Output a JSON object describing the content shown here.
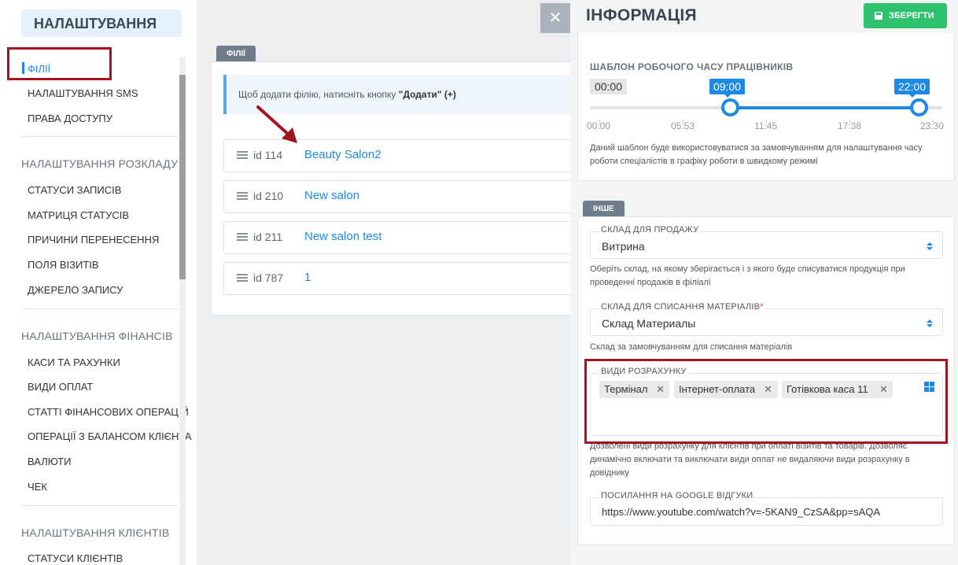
{
  "sidebar": {
    "header": "НАЛАШТУВАННЯ",
    "active_item": "ФІЛІЇ",
    "items_group1": [
      "НАЛАШТУВАННЯ SMS",
      "ПРАВА ДОСТУПУ"
    ],
    "section_schedule": "НАЛАШТУВАННЯ РОЗКЛАДУ",
    "items_schedule": [
      "СТАТУСИ ЗАПИСІВ",
      "МАТРИЦЯ СТАТУСІВ",
      "ПРИЧИНИ ПЕРЕНЕСЕННЯ",
      "ПОЛЯ ВІЗИТІВ",
      "ДЖЕРЕЛО ЗАПИСУ"
    ],
    "section_finance": "НАЛАШТУВАННЯ ФІНАНСІВ",
    "items_finance": [
      "КАСИ ТА РАХУНКИ",
      "ВИДИ ОПЛАТ",
      "СТАТТІ ФІНАНСОВИХ ОПЕРАЦІЙ",
      "ОПЕРАЦІЇ З БАЛАНСОМ КЛІЄНТА",
      "ВАЛЮТИ",
      "ЧЕК"
    ],
    "section_clients": "НАЛАШТУВАННЯ КЛІЄНТІВ",
    "items_clients": [
      "СТАТУСИ КЛІЄНТІВ"
    ]
  },
  "branches": {
    "tab_label": "ФІЛІЇ",
    "info_text_prefix": "Щоб додати філію, натисніть кнопку ",
    "info_text_bold": "\"Додати\" (+)",
    "rows": [
      {
        "id": "id 114",
        "name": "Beauty Salon2"
      },
      {
        "id": "id 210",
        "name": "New salon"
      },
      {
        "id": "id 211",
        "name": "New salon test"
      },
      {
        "id": "id 787",
        "name": "1"
      }
    ]
  },
  "close_label": "✕",
  "info_panel": {
    "title": "ІНФОРМАЦІЯ",
    "save_label": "ЗБЕРЕГТИ",
    "schedule": {
      "title": "ШАБЛОН РОБОЧОГО ЧАСУ ПРАЦІВНИКІВ",
      "min_label": "00:00",
      "from": "09:00",
      "to": "22:00",
      "from_fraction": 0.3913,
      "to_fraction": 0.9565,
      "ticks": [
        "00:00",
        "05:53",
        "11:45",
        "17:38",
        "23:30"
      ],
      "help": "Даний шаблон буде використовуватися за замовчуванням для налаштування часу роботи спеціалістів в графіку роботи в швидкому режимі"
    },
    "other": {
      "tab_label": "ІНШЕ",
      "sale_stock": {
        "label": "СКЛАД ДЛЯ ПРОДАЖУ",
        "value": "Витрина",
        "help": "Оберіть склад, на якому зберігається і з якого буде списуватися продукція при проведенні продажів в філіалі"
      },
      "materials_stock": {
        "label": "СКЛАД ДЛЯ СПИСАННЯ МАТЕРІАЛІВ",
        "required_mark": "*",
        "value": "Склад Материалы",
        "help": "Склад за замовчуванням для списання матеріалів"
      },
      "payment_types": {
        "label": "ВИДИ РОЗРАХУНКУ",
        "tags": [
          "Термінал",
          "Інтернет-оплата",
          "Готівкова каса 11"
        ],
        "remove_glyph": "✕",
        "help": "Дозволені види розрахунку для клієнтів при оплаті візитів та товарів. Дозволяє динамічно включати та виключати види оплат не видаляючи види розрахунку в довіднику"
      },
      "google_reviews": {
        "label": "ПОСИЛАННЯ НА GOOGLE ВІДГУКИ",
        "value": "https://www.youtube.com/watch?v=-5KAN9_CzSA&pp=sAQA"
      }
    }
  },
  "colors": {
    "accent": "#1e88e5",
    "save_green": "#2ec26f",
    "highlight_red": "#a3151e",
    "arrow_red": "#a3151e"
  }
}
